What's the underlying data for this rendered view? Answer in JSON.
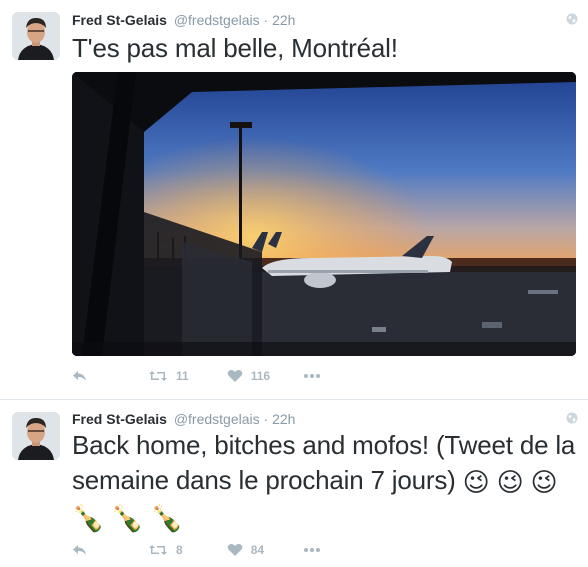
{
  "tweets": [
    {
      "author_name": "Fred St-Gelais",
      "handle": "@fredstgelais",
      "separator": "·",
      "time": "22h",
      "text": "T'es pas mal belle, Montréal!",
      "retweets": "11",
      "likes": "116"
    },
    {
      "author_name": "Fred St-Gelais",
      "handle": "@fredstgelais",
      "separator": "·",
      "time": "22h",
      "text": "Back home, bitches and mofos! (Tweet de la semaine dans le prochain 7 jours)",
      "emojis": [
        "😉",
        "😉",
        "😉",
        "🍾",
        "🍾",
        "🍾"
      ],
      "retweets": "8",
      "likes": "84"
    }
  ],
  "colors": {
    "text": "#292f33",
    "muted": "#8899a6",
    "icon": "#aab8c2",
    "divider": "#e1e8ed"
  },
  "icons": [
    "globe-icon",
    "reply-icon",
    "retweet-icon",
    "heart-icon",
    "more-icon"
  ]
}
